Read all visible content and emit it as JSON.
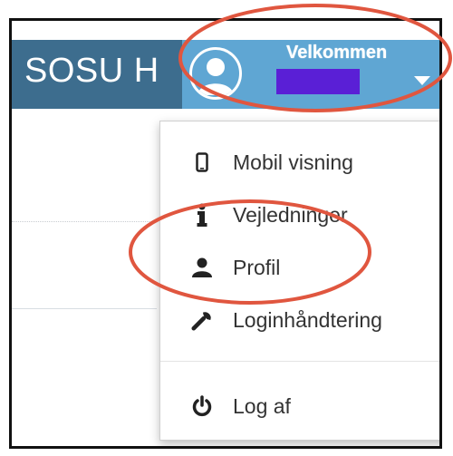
{
  "header": {
    "brand": "SOSU H",
    "welcome": "Velkommen",
    "user_name_redacted": true
  },
  "menu": {
    "items": [
      {
        "label": "Mobil visning",
        "icon": "mobile-icon"
      },
      {
        "label": "Vejledninger",
        "icon": "info-icon"
      },
      {
        "label": "Profil",
        "icon": "user-icon"
      },
      {
        "label": "Loginhåndtering",
        "icon": "wrench-icon"
      }
    ],
    "logout": {
      "label": "Log af",
      "icon": "power-icon"
    }
  },
  "colors": {
    "header_dark": "#3d6d8e",
    "header_light": "#5fa6d3",
    "redaction": "#5a1fd6",
    "annotation": "#e0563f"
  }
}
